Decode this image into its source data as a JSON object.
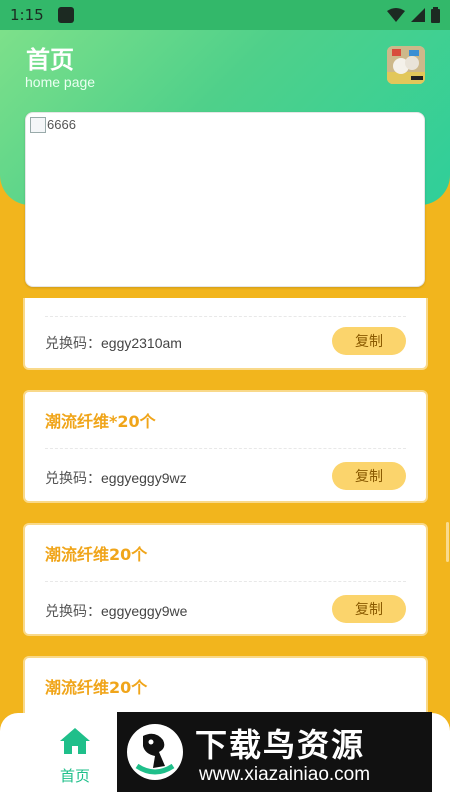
{
  "status_bar": {
    "time": "1:15"
  },
  "header": {
    "title": "首页",
    "subtitle": "home page"
  },
  "banner": {
    "alt_text": "6666"
  },
  "cards": [
    {
      "title": "",
      "code_label": "兑换码：",
      "code": "eggy2310am",
      "copy_label": "复制"
    },
    {
      "title": "潮流纤维*20个",
      "code_label": "兑换码：",
      "code": "eggyeggy9wz",
      "copy_label": "复制"
    },
    {
      "title": "潮流纤维20个",
      "code_label": "兑换码：",
      "code": "eggyeggy9we",
      "copy_label": "复制"
    },
    {
      "title": "潮流纤维20个",
      "code_label": "",
      "code": "",
      "copy_label": ""
    }
  ],
  "tabbar": {
    "home_label": "首页"
  },
  "watermark": {
    "title": "下载鸟资源",
    "url": "www.xiazainiao.com"
  },
  "colors": {
    "header_green": "#4fd08a",
    "page_bg": "#f2b51d",
    "accent_orange": "#f0a51a",
    "copy_button": "#fbd46c",
    "tab_active": "#1fbf8a"
  }
}
